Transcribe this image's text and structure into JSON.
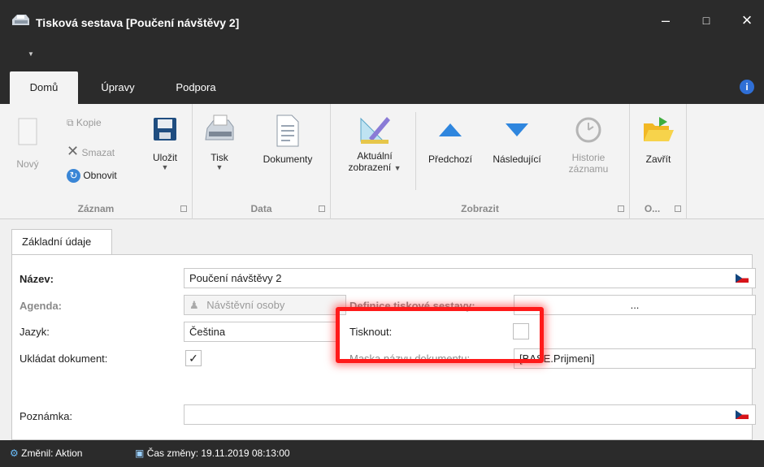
{
  "window": {
    "title": "Tisková sestava [Poučení návštěvy 2]",
    "minimize": "–",
    "maximize": "□",
    "close": "×"
  },
  "tabs": [
    "Domů",
    "Úpravy",
    "Podpora"
  ],
  "ribbon": {
    "zaznam": {
      "label": "Záznam",
      "novy": "Nový",
      "kopie": "Kopie",
      "smazat": "Smazat",
      "obnovit": "Obnovit",
      "ulozit": "Uložit"
    },
    "data": {
      "label": "Data",
      "tisk": "Tisk",
      "dokumenty": "Dokumenty"
    },
    "zobrazit": {
      "label": "Zobrazit",
      "aktualni_1": "Aktuální",
      "aktualni_2": "zobrazení",
      "predchozi": "Předchozí",
      "nasledujici": "Následující",
      "historie_1": "Historie",
      "historie_2": "záznamu"
    },
    "o": {
      "label": "O...",
      "zavrit": "Zavřít"
    }
  },
  "form": {
    "tab": "Základní údaje",
    "nazev_label": "Název:",
    "nazev_value": "Poučení návštěvy 2",
    "agenda_label": "Agenda:",
    "agenda_value": "Návštěvní osoby",
    "definice_label": "Definice tiskové sestavy:",
    "definice_value": "...",
    "jazyk_label": "Jazyk:",
    "jazyk_value": "Čeština",
    "tisknout_label": "Tisknout:",
    "ukladat_label": "Ukládat dokument:",
    "ukladat_check": "✓",
    "maska_label": "Maska názvu dokumentu:",
    "maska_value": "[BASE.Prijmeni]",
    "poznamka_label": "Poznámka:"
  },
  "status": {
    "changed_by": "Změnil: Aktion",
    "changed_time": "Čas změny: 19.11.2019 08:13:00"
  },
  "colors": {
    "accent": "#2f6fd6",
    "highlight": "#ff1a1a",
    "dark": "#2b2b2b"
  }
}
